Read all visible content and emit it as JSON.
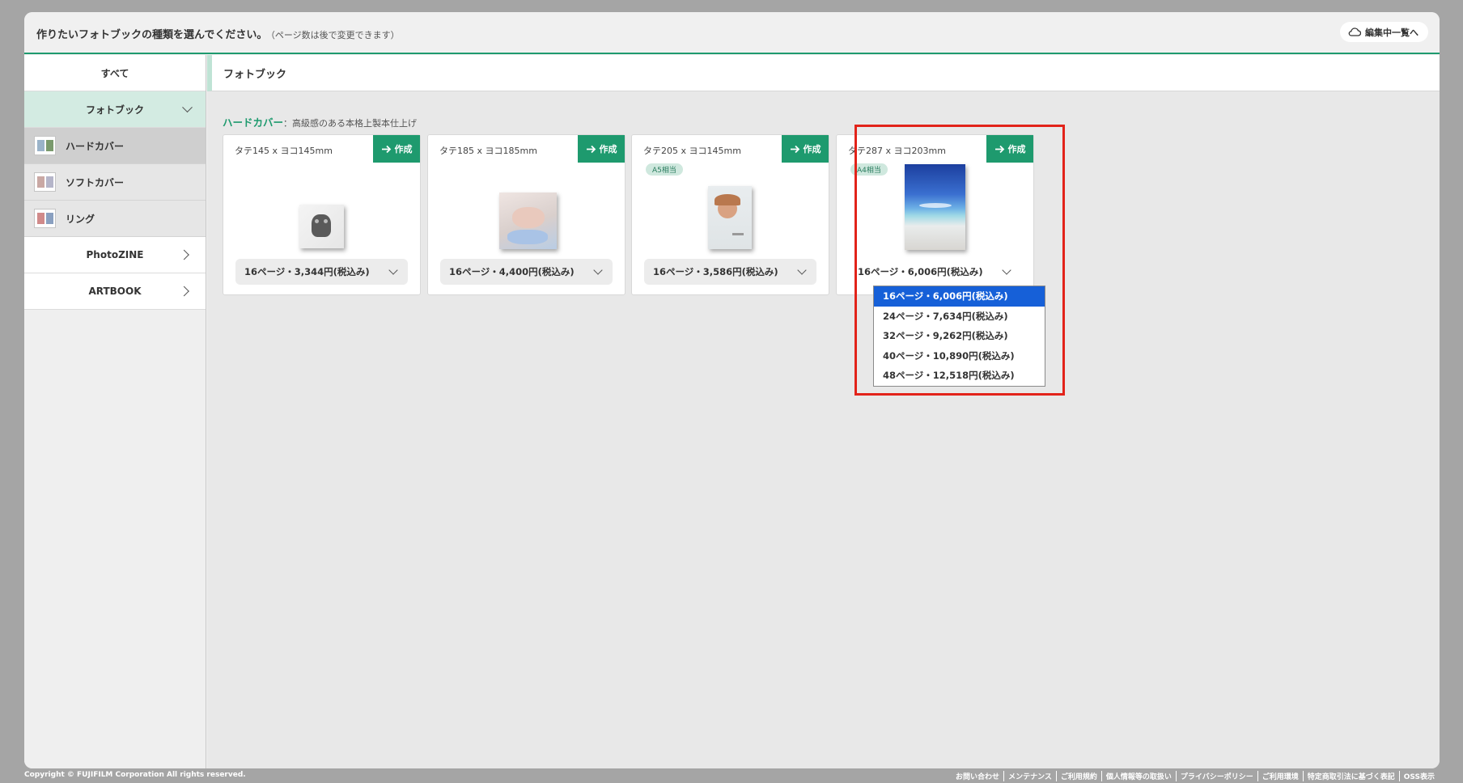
{
  "header": {
    "title": "作りたいフォトブックの種類を選んでください。",
    "note": "（ページ数は後で変更できます）",
    "edit_button": "編集中一覧へ"
  },
  "sidebar": {
    "all": "すべて",
    "photobook": "フォトブック",
    "sub_items": [
      "ハードカバー",
      "ソフトカバー",
      "リング"
    ],
    "photozine": "PhotoZINE",
    "artbook": "ARTBOOK"
  },
  "main": {
    "title": "フォトブック",
    "section_name": "ハードカバー",
    "section_desc": "：高級感のある本格上製本仕上げ",
    "create_label": "作成",
    "cards": [
      {
        "size": "タテ145 x ヨコ145mm",
        "badge": "",
        "price": "16ページ・3,344円(税込み)"
      },
      {
        "size": "タテ185 x ヨコ185mm",
        "badge": "",
        "price": "16ページ・4,400円(税込み)"
      },
      {
        "size": "タテ205 x ヨコ145mm",
        "badge": "A5相当",
        "price": "16ページ・3,586円(税込み)"
      },
      {
        "size": "タテ287 x ヨコ203mm",
        "badge": "A4相当",
        "price": "16ページ・6,006円(税込み)"
      }
    ],
    "dropdown_options": [
      "16ページ・6,006円(税込み)",
      "24ページ・7,634円(税込み)",
      "32ページ・9,262円(税込み)",
      "40ページ・10,890円(税込み)",
      "48ページ・12,518円(税込み)"
    ]
  },
  "footer": {
    "copyright": "Copyright © FUJIFILM Corporation All rights reserved.",
    "links": [
      "お問い合わせ",
      "メンテナンス",
      "ご利用規約",
      "個人情報等の取扱い",
      "プライバシーポリシー",
      "ご利用環境",
      "特定商取引法に基づく表記",
      "OSS表示"
    ]
  },
  "colors": {
    "accent": "#1e9a6e",
    "highlight": "#e2231a",
    "selected_option": "#1660d8"
  }
}
